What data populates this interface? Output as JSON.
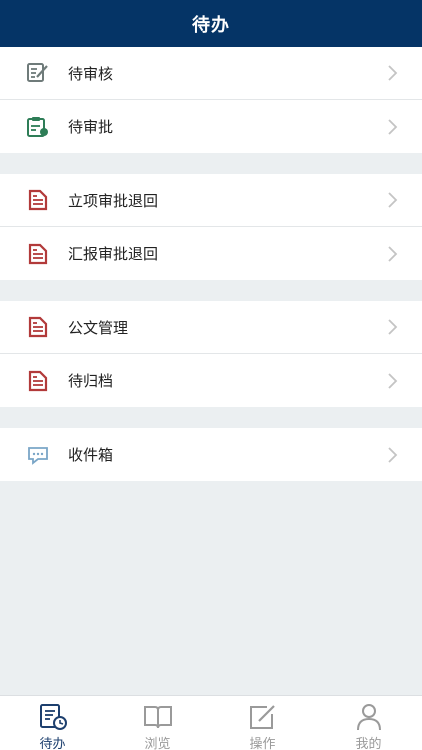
{
  "header": {
    "title": "待办"
  },
  "groups": [
    {
      "items": [
        {
          "label": "待审核",
          "icon": "edit-note-icon"
        },
        {
          "label": "待审批",
          "icon": "approval-clipboard-icon"
        }
      ]
    },
    {
      "items": [
        {
          "label": "立项审批退回",
          "icon": "document-icon"
        },
        {
          "label": "汇报审批退回",
          "icon": "document-icon"
        }
      ]
    },
    {
      "items": [
        {
          "label": "公文管理",
          "icon": "document-icon"
        },
        {
          "label": "待归档",
          "icon": "document-icon"
        }
      ]
    },
    {
      "items": [
        {
          "label": "收件箱",
          "icon": "message-icon"
        }
      ]
    }
  ],
  "tabbar": {
    "tabs": [
      {
        "label": "待办",
        "icon": "todo-clock-icon",
        "active": true
      },
      {
        "label": "浏览",
        "icon": "book-icon",
        "active": false
      },
      {
        "label": "操作",
        "icon": "edit-square-icon",
        "active": false
      },
      {
        "label": "我的",
        "icon": "user-icon",
        "active": false
      }
    ]
  },
  "colors": {
    "header_bg": "#053466",
    "page_bg": "#ebeff1",
    "doc_icon": "#b23a3a",
    "green_icon": "#2e7d57",
    "gray_icon": "#6f7b7a",
    "message_icon": "#7aa6c7",
    "active_tab": "#1d3f6e",
    "inactive_tab": "#9a9a9a"
  }
}
